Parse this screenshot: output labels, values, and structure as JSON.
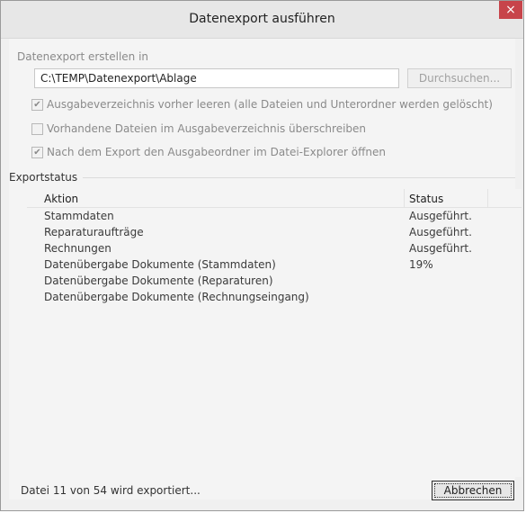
{
  "window": {
    "title": "Datenexport ausführen",
    "close_glyph": "×"
  },
  "destination": {
    "label": "Datenexport erstellen in",
    "path": "C:\\TEMP\\Datenexport\\Ablage",
    "browse_label": "Durchsuchen..."
  },
  "options": [
    {
      "label": "Ausgabeverzeichnis vorher leeren (alle Dateien und Unterordner werden gelöscht)",
      "checked": true
    },
    {
      "label": "Vorhandene Dateien im Ausgabeverzeichnis überschreiben",
      "checked": false
    },
    {
      "label": "Nach dem Export den Ausgabeordner im Datei-Explorer öffnen",
      "checked": true
    }
  ],
  "export_status": {
    "group_label": "Exportstatus",
    "columns": {
      "action": "Aktion",
      "status": "Status"
    },
    "rows": [
      {
        "action": "Stammdaten",
        "status": "Ausgeführt."
      },
      {
        "action": "Reparaturaufträge",
        "status": "Ausgeführt."
      },
      {
        "action": "Rechnungen",
        "status": "Ausgeführt."
      },
      {
        "action": "Datenübergabe Dokumente (Stammdaten)",
        "status": "19%"
      },
      {
        "action": "Datenübergabe Dokumente (Reparaturen)",
        "status": ""
      },
      {
        "action": "Datenübergabe Dokumente (Rechnungseingang)",
        "status": ""
      }
    ]
  },
  "footer": {
    "progress_text": "Datei 11 von 54 wird exportiert...",
    "cancel_label": "Abbrechen"
  }
}
